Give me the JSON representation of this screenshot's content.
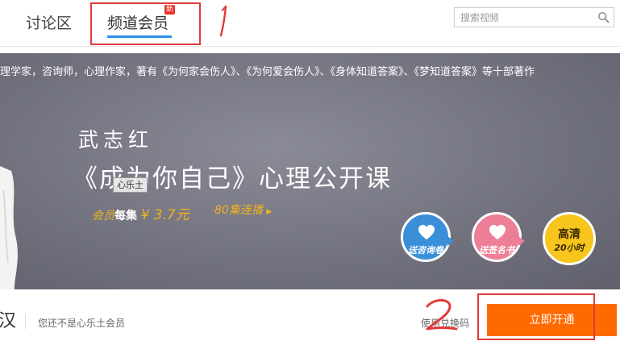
{
  "tabs": {
    "discuss_label": "讨论区",
    "member_label": "频道会员",
    "new_badge": "新"
  },
  "search": {
    "placeholder": "搜索视频",
    "icon": "search-icon"
  },
  "annotations": {
    "mark_1": "1",
    "mark_2": "2",
    "color": "#e23a3a"
  },
  "banner": {
    "marquee": "理学家，咨询师，心理作家，著有《为何家会伤人》、《为何爱会伤人》、《身体知道答案》、《梦知道答案》等十部著作",
    "author": "武志红",
    "title": "《成为你自己》心理公开课",
    "watermark": "心乐土",
    "price_prefix": "会员",
    "price_each": "每集",
    "price_amount": "¥ 3.7元",
    "episodes": "80集连播",
    "badges": {
      "consult": "送咨询卷",
      "sign": "送签名书",
      "hd_main": "高清",
      "hd_sub": "20小时"
    }
  },
  "bottom": {
    "left_glyph": "汉",
    "not_member": "您还不是心乐土会员",
    "redeem": "使用兑换码",
    "open_button": "立即开通"
  },
  "colors": {
    "accent_blue": "#2b8ee6",
    "action_orange": "#ff6a00",
    "banner_gray": "#72737f",
    "price_gold": "#f2b21c"
  }
}
